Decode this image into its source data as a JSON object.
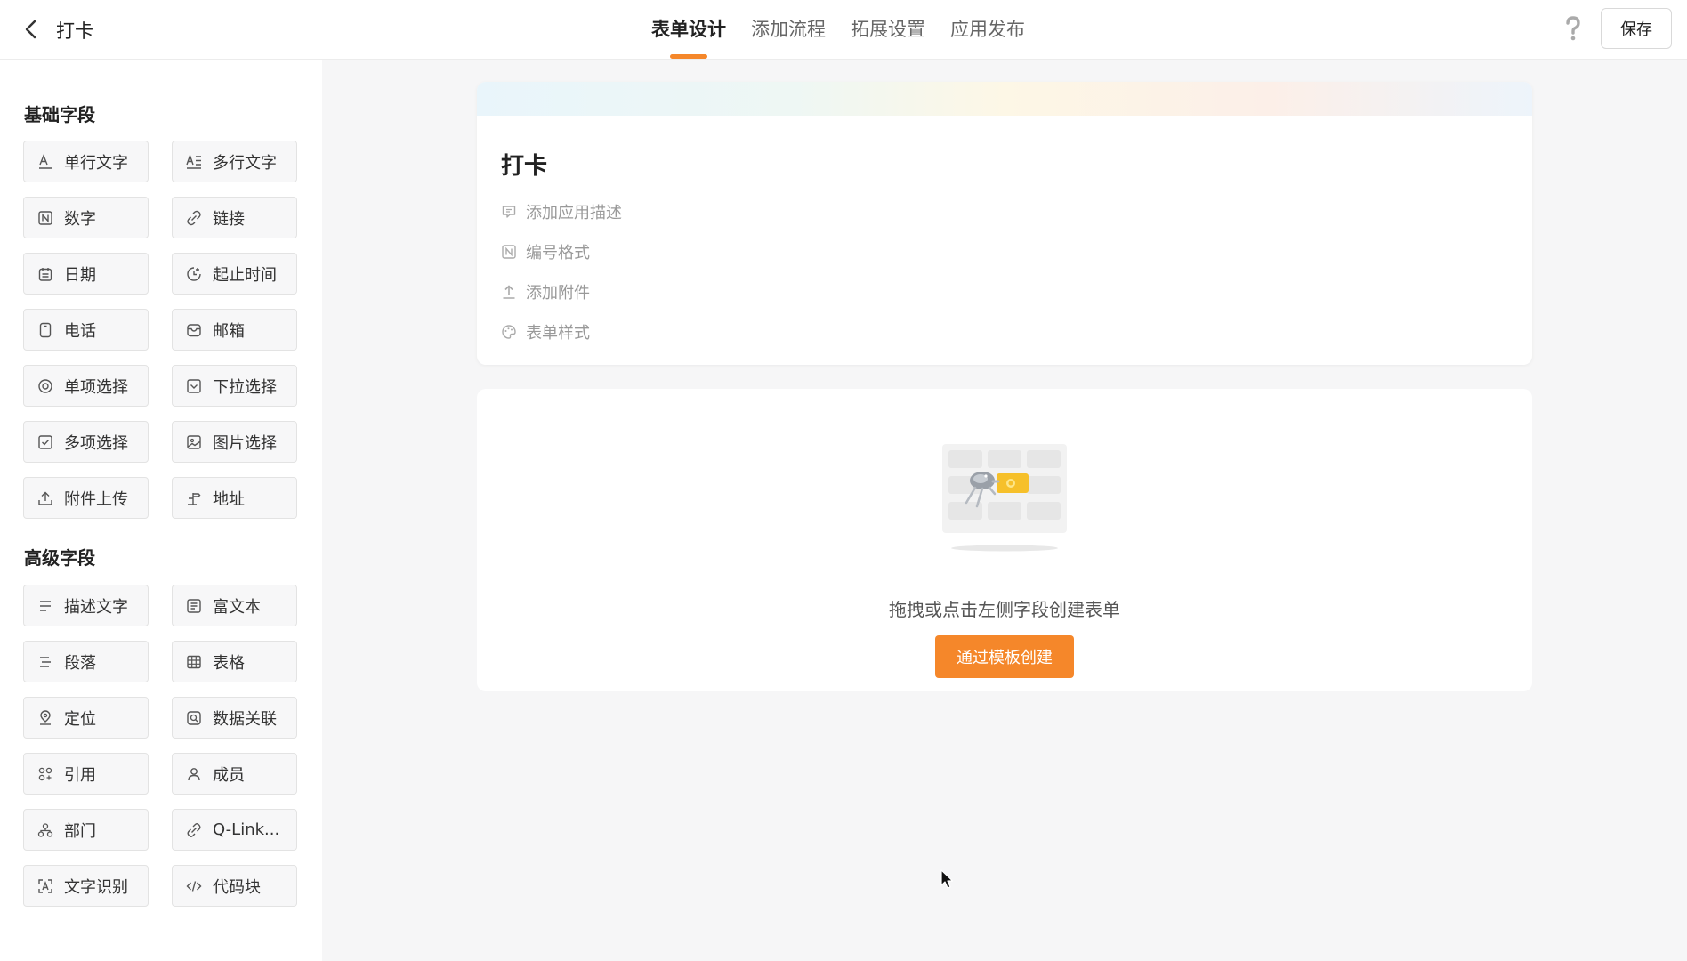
{
  "header": {
    "title": "打卡",
    "tabs": [
      {
        "label": "表单设计",
        "active": true
      },
      {
        "label": "添加流程",
        "active": false
      },
      {
        "label": "拓展设置",
        "active": false
      },
      {
        "label": "应用发布",
        "active": false
      }
    ],
    "save_label": "保存",
    "accent_color": "#f5872a"
  },
  "sidebar": {
    "basic_title": "基础字段",
    "basic_fields": [
      {
        "label": "单行文字",
        "icon": "single-line-text-icon"
      },
      {
        "label": "多行文字",
        "icon": "multi-line-text-icon"
      },
      {
        "label": "数字",
        "icon": "number-icon"
      },
      {
        "label": "链接",
        "icon": "link-icon"
      },
      {
        "label": "日期",
        "icon": "calendar-icon"
      },
      {
        "label": "起止时间",
        "icon": "time-range-icon"
      },
      {
        "label": "电话",
        "icon": "phone-icon"
      },
      {
        "label": "邮箱",
        "icon": "mail-icon"
      },
      {
        "label": "单项选择",
        "icon": "radio-icon"
      },
      {
        "label": "下拉选择",
        "icon": "dropdown-icon"
      },
      {
        "label": "多项选择",
        "icon": "checkbox-icon"
      },
      {
        "label": "图片选择",
        "icon": "image-icon"
      },
      {
        "label": "附件上传",
        "icon": "upload-icon"
      },
      {
        "label": "地址",
        "icon": "address-icon"
      }
    ],
    "advanced_title": "高级字段",
    "advanced_fields": [
      {
        "label": "描述文字",
        "icon": "description-icon"
      },
      {
        "label": "富文本",
        "icon": "rich-text-icon"
      },
      {
        "label": "段落",
        "icon": "paragraph-icon"
      },
      {
        "label": "表格",
        "icon": "table-icon"
      },
      {
        "label": "定位",
        "icon": "location-icon"
      },
      {
        "label": "数据关联",
        "icon": "data-link-icon"
      },
      {
        "label": "引用",
        "icon": "reference-icon"
      },
      {
        "label": "成员",
        "icon": "member-icon"
      },
      {
        "label": "部门",
        "icon": "department-icon"
      },
      {
        "label": "Q-Link...",
        "icon": "q-link-icon"
      },
      {
        "label": "文字识别",
        "icon": "ocr-icon"
      },
      {
        "label": "代码块",
        "icon": "code-icon"
      }
    ]
  },
  "form": {
    "title": "打卡",
    "options": [
      {
        "label": "添加应用描述",
        "icon": "comment-icon"
      },
      {
        "label": "编号格式",
        "icon": "number-format-icon"
      },
      {
        "label": "添加附件",
        "icon": "attachment-upload-icon"
      },
      {
        "label": "表单样式",
        "icon": "palette-icon"
      }
    ]
  },
  "empty_state": {
    "text": "拖拽或点击左侧字段创建表单",
    "button_label": "通过模板创建"
  }
}
